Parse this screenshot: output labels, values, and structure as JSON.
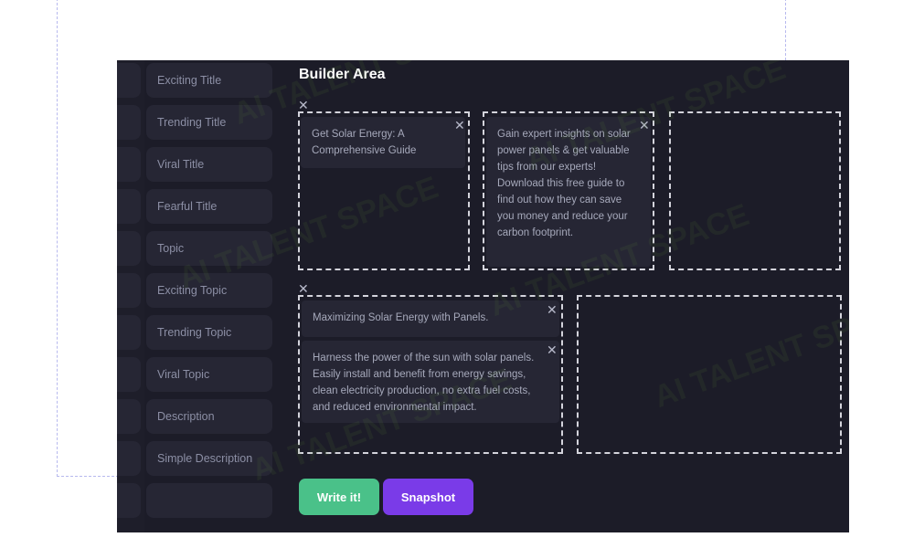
{
  "sidebar": {
    "items": [
      {
        "label": "Exciting Title"
      },
      {
        "label": "Trending Title"
      },
      {
        "label": "Viral Title"
      },
      {
        "label": "Fearful Title"
      },
      {
        "label": "Topic"
      },
      {
        "label": "Exciting Topic"
      },
      {
        "label": "Trending Topic"
      },
      {
        "label": "Viral Topic"
      },
      {
        "label": "Description"
      },
      {
        "label": "Simple Description"
      }
    ]
  },
  "builder": {
    "title": "Builder Area",
    "row1": {
      "card1": "Get Solar Energy: A Comprehensive Guide",
      "card2": "Gain expert insights on solar power panels & get valuable tips from our experts! Download this free guide to find out how they can save you money and reduce your carbon footprint."
    },
    "row2": {
      "card1": "Maximizing Solar Energy with Panels.",
      "card2": "Harness the power of the sun with solar panels. Easily install and benefit from energy savings, clean electricity production, no extra fuel costs, and reduced environmental impact."
    }
  },
  "buttons": {
    "write": "Write it!",
    "snapshot": "Snapshot"
  },
  "watermark": "AI TALENT SPACE",
  "icons": {
    "remove": "close-icon"
  },
  "colors": {
    "background": "#1c1c28",
    "panel": "#262634",
    "write_button": "#4ac189",
    "snapshot_button": "#7a3be8"
  }
}
